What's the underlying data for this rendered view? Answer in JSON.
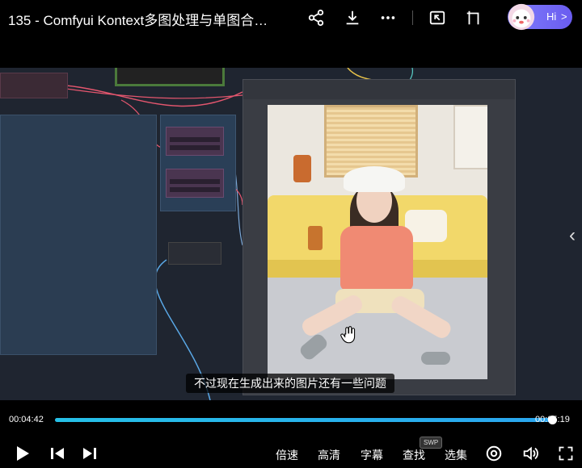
{
  "header": {
    "title": "135 - Comfyui Kontext多图处理与单图合…",
    "hi_label": "Hi",
    "hi_chevron": ">"
  },
  "video": {
    "subtitle": "不过现在生成出来的图片还有一些问题",
    "side_chevron": "‹"
  },
  "player": {
    "current_time": "00:04:42",
    "total_time": "00:05:19",
    "progress": 0.996,
    "speed_label": "倍速",
    "quality_label": "高清",
    "subtitle_label": "字幕",
    "search_label": "查找",
    "search_badge": "SWP",
    "episodes_label": "选集"
  },
  "colors": {
    "accent": "#26c0e7",
    "badge": "#7f7dfb"
  }
}
